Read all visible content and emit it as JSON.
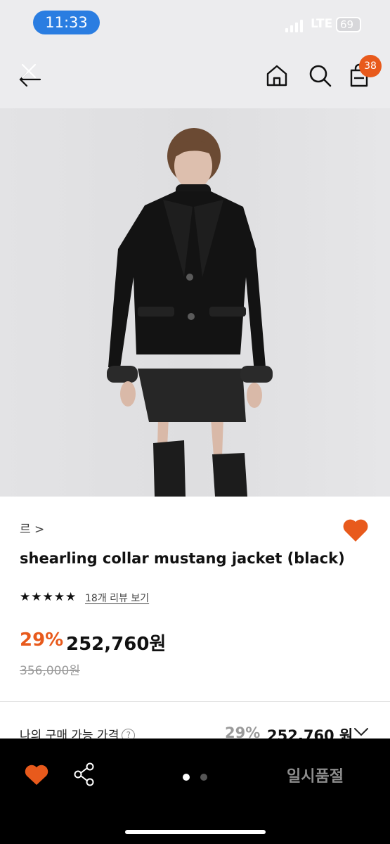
{
  "status_bar": {
    "time": "11:33",
    "carrier": "LTE",
    "battery": "69"
  },
  "header": {
    "cart_count": "38"
  },
  "product": {
    "brand": "르 >",
    "title": "shearling collar mustang jacket (black)",
    "stars": "★★★★★",
    "review_link": "18개 리뷰 보기",
    "discount": "29%",
    "price": "252,760원",
    "original_price": "356,000원"
  },
  "my_price": {
    "label": "나의 구매 가능 가격",
    "discount": "29%",
    "price": "252,760 원"
  },
  "bottom_bar": {
    "soldout_label": "일시품절"
  },
  "colors": {
    "accent": "#e85a1c",
    "status_pill": "#2a7de1",
    "bottom_bar": "#000000"
  }
}
